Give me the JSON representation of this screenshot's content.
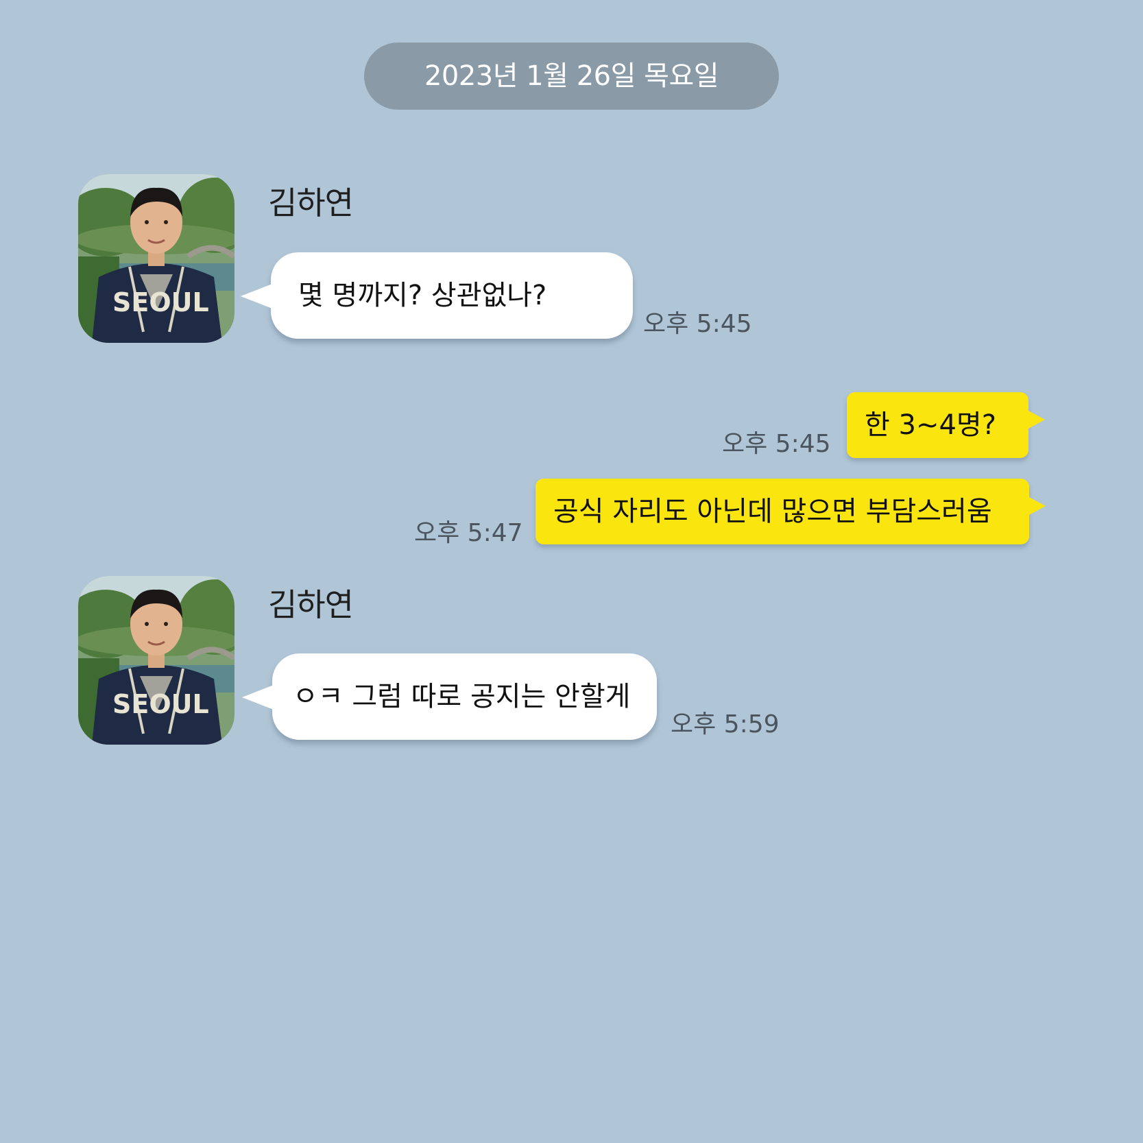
{
  "date_divider": "2023년 1월 26일 목요일",
  "messages": [
    {
      "sender": "김하연",
      "text": "몇 명까지? 상관없나?",
      "time": "오후 5:45",
      "direction": "incoming"
    },
    {
      "text": "한 3~4명?",
      "time": "오후 5:45",
      "direction": "outgoing"
    },
    {
      "text": "공식 자리도 아닌데 많으면 부담스러움",
      "time": "오후 5:47",
      "direction": "outgoing"
    },
    {
      "sender": "김하연",
      "text": "ㅇㅋ 그럼 따로 공지는 안할게",
      "time": "오후 5:59",
      "direction": "incoming"
    }
  ],
  "colors": {
    "background": "#b0c6d7",
    "date_pill": "#8a9ba7",
    "incoming_bubble": "#ffffff",
    "outgoing_bubble": "#fbe50e"
  },
  "avatar_icon": "profile-photo-young-man-seoul-jacket"
}
